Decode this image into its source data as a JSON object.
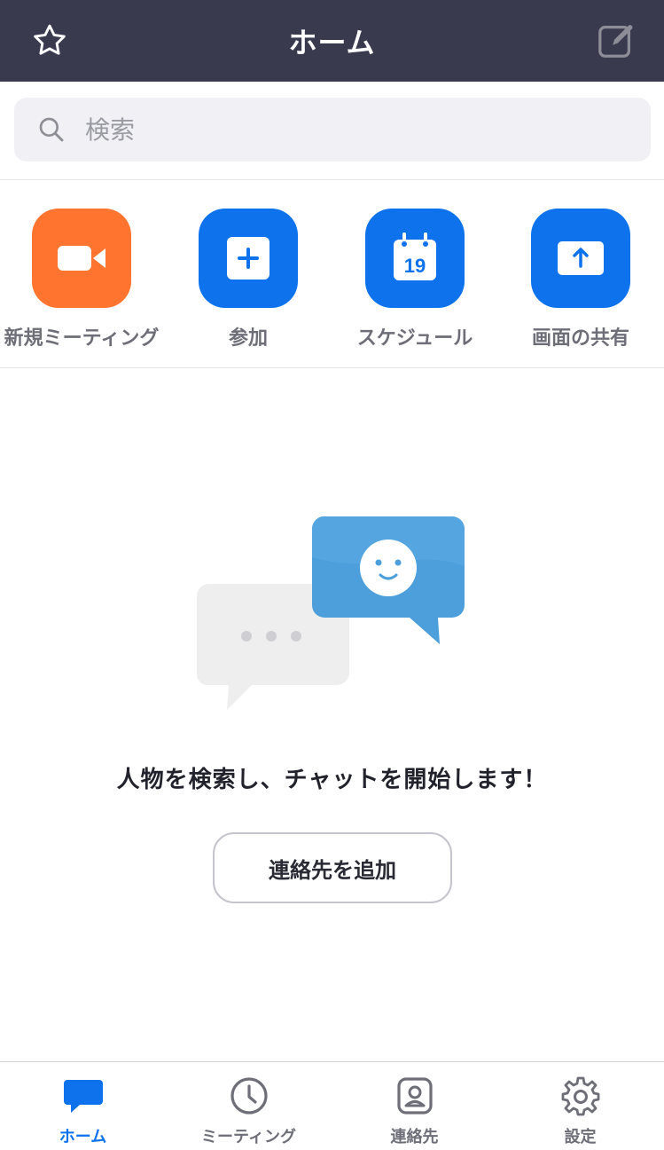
{
  "header": {
    "title": "ホーム",
    "left_icon": "star-icon",
    "right_icon": "compose-icon"
  },
  "search": {
    "placeholder": "検索",
    "value": ""
  },
  "actions": [
    {
      "label": "新規ミーティング",
      "icon": "video-camera-icon",
      "color": "#ff742e"
    },
    {
      "label": "参加",
      "icon": "plus-icon",
      "color": "#0e72ed"
    },
    {
      "label": "スケジュール",
      "icon": "calendar-icon",
      "color": "#0e72ed",
      "calendar_day": "19"
    },
    {
      "label": "画面の共有",
      "icon": "share-screen-icon",
      "color": "#0e72ed"
    }
  ],
  "empty_state": {
    "message": "人物を検索し、チャットを開始します！",
    "button_label": "連絡先を追加"
  },
  "tabbar": {
    "items": [
      {
        "label": "ホーム",
        "icon": "chat-bubble-icon",
        "active": true
      },
      {
        "label": "ミーティング",
        "icon": "clock-icon",
        "active": false
      },
      {
        "label": "連絡先",
        "icon": "contact-card-icon",
        "active": false
      },
      {
        "label": "設定",
        "icon": "gear-icon",
        "active": false
      }
    ]
  },
  "colors": {
    "header_bg": "#3a3a4f",
    "accent_blue": "#0e72ed",
    "accent_orange": "#ff742e"
  }
}
